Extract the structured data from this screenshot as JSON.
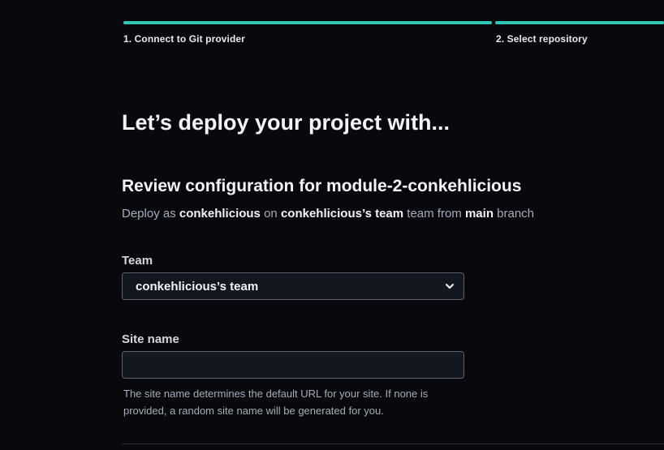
{
  "steps": [
    {
      "label": "1. Connect to Git provider",
      "complete": true
    },
    {
      "label": "2. Select repository",
      "complete": true
    }
  ],
  "heading": "Let’s deploy your project with...",
  "review": {
    "title": "Review configuration for module-2-conkehlicious",
    "prefix": "Deploy as",
    "user": "conkehlicious",
    "on": "on",
    "team": "conkehlicious’s team",
    "team_from": "team from",
    "branch": "main",
    "branch_suffix": "branch"
  },
  "team_field": {
    "label": "Team",
    "selected": "conkehlicious’s team"
  },
  "site_name_field": {
    "label": "Site name",
    "value": "",
    "help": "The site name determines the default URL for your site. If none is provided, a random site name will be generated for you."
  },
  "colors": {
    "accent": "#30c8b4",
    "background": "#07090d",
    "input_bg": "#121720",
    "input_border": "#5c636d"
  },
  "icons": {
    "select_chevron": "chevron-down-icon"
  }
}
